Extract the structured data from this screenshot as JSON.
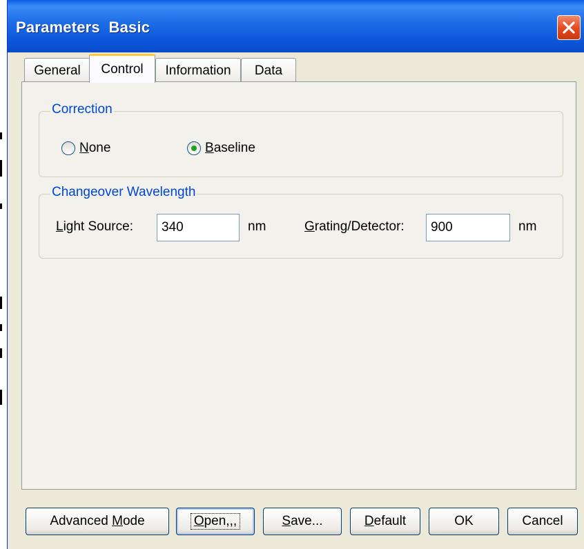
{
  "window": {
    "title": "Parameters  Basic"
  },
  "tabs": [
    {
      "label": "General",
      "active": false
    },
    {
      "label": "Control",
      "active": true
    },
    {
      "label": "Information",
      "active": false
    },
    {
      "label": "Data",
      "active": false
    }
  ],
  "correction": {
    "title": "Correction",
    "options": [
      {
        "mnemonic": "N",
        "rest": "one",
        "selected": false
      },
      {
        "mnemonic": "B",
        "rest": "aseline",
        "selected": true
      }
    ]
  },
  "changeover": {
    "title": "Changeover Wavelength",
    "light_source": {
      "mnemonic": "L",
      "rest": "ight Source:",
      "value": "340",
      "unit": "nm"
    },
    "grating": {
      "mnemonic": "G",
      "rest": "rating/Detector:",
      "value": "900",
      "unit": "nm"
    }
  },
  "buttons": {
    "advanced": {
      "pre": "Advanced ",
      "mnemonic": "M",
      "rest": "ode"
    },
    "open": {
      "mnemonic": "O",
      "rest": "pen,,,"
    },
    "save": {
      "mnemonic": "S",
      "rest": "ave..."
    },
    "default": {
      "mnemonic": "D",
      "rest": "efault"
    },
    "ok": {
      "label": "OK"
    },
    "cancel": {
      "label": "Cancel"
    }
  },
  "colors": {
    "title_bar": "#0a5fe0",
    "group_title": "#0046d5",
    "close_button": "#e2491f",
    "active_tab_accent": "#ffc83c"
  }
}
